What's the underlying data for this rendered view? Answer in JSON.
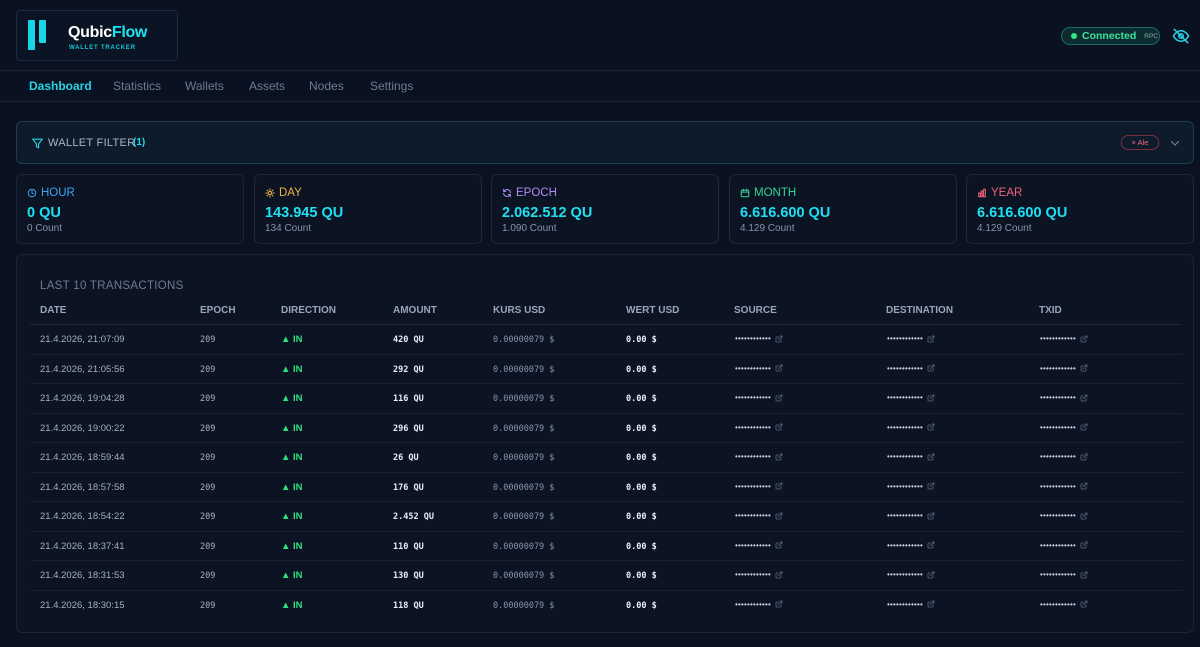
{
  "brand": {
    "name_white": "Qubic",
    "name_cyan": "Flow",
    "subtitle": "WALLET TRACKER"
  },
  "status": {
    "connected_label": "Connected",
    "rpc_label": "RPC"
  },
  "nav": {
    "tabs": [
      {
        "label": "Dashboard"
      },
      {
        "label": "Statistics"
      },
      {
        "label": "Wallets"
      },
      {
        "label": "Assets"
      },
      {
        "label": "Nodes"
      },
      {
        "label": "Settings"
      }
    ],
    "active": "Dashboard"
  },
  "filter": {
    "label": "WALLET FILTER",
    "count": "(1)",
    "tag": "× Ale"
  },
  "stats": [
    {
      "label": "HOUR",
      "value": "0 QU",
      "count": "0 Count",
      "color": "#3aa6f0",
      "icon": "clock-icon"
    },
    {
      "label": "DAY",
      "value": "143.945 QU",
      "count": "134 Count",
      "color": "#f2b33d",
      "icon": "sun-icon"
    },
    {
      "label": "EPOCH",
      "value": "2.062.512 QU",
      "count": "1.090 Count",
      "color": "#b18cf2",
      "icon": "refresh-icon"
    },
    {
      "label": "MONTH",
      "value": "6.616.600 QU",
      "count": "4.129 Count",
      "color": "#34d399",
      "icon": "calendar-icon"
    },
    {
      "label": "YEAR",
      "value": "6.616.600 QU",
      "count": "4.129 Count",
      "color": "#f2617a",
      "icon": "bar-chart-icon"
    }
  ],
  "transactions": {
    "title": "LAST 10 TRANSACTIONS",
    "columns": [
      "DATE",
      "EPOCH",
      "DIRECTION",
      "AMOUNT",
      "KURS USD",
      "WERT USD",
      "SOURCE",
      "DESTINATION",
      "TXID"
    ],
    "masked": "••••••••••••",
    "rows": [
      {
        "date": "21.4.2026, 21:07:09",
        "epoch": "209",
        "direction": "▲ IN",
        "amount": "420 QU",
        "kurs": "0.00000079 $",
        "wert": "0.00 $"
      },
      {
        "date": "21.4.2026, 21:05:56",
        "epoch": "209",
        "direction": "▲ IN",
        "amount": "292 QU",
        "kurs": "0.00000079 $",
        "wert": "0.00 $"
      },
      {
        "date": "21.4.2026, 19:04:28",
        "epoch": "209",
        "direction": "▲ IN",
        "amount": "116 QU",
        "kurs": "0.00000079 $",
        "wert": "0.00 $"
      },
      {
        "date": "21.4.2026, 19:00:22",
        "epoch": "209",
        "direction": "▲ IN",
        "amount": "296 QU",
        "kurs": "0.00000079 $",
        "wert": "0.00 $"
      },
      {
        "date": "21.4.2026, 18:59:44",
        "epoch": "209",
        "direction": "▲ IN",
        "amount": "26 QU",
        "kurs": "0.00000079 $",
        "wert": "0.00 $"
      },
      {
        "date": "21.4.2026, 18:57:58",
        "epoch": "209",
        "direction": "▲ IN",
        "amount": "176 QU",
        "kurs": "0.00000079 $",
        "wert": "0.00 $"
      },
      {
        "date": "21.4.2026, 18:54:22",
        "epoch": "209",
        "direction": "▲ IN",
        "amount": "2.452 QU",
        "kurs": "0.00000079 $",
        "wert": "0.00 $"
      },
      {
        "date": "21.4.2026, 18:37:41",
        "epoch": "209",
        "direction": "▲ IN",
        "amount": "110 QU",
        "kurs": "0.00000079 $",
        "wert": "0.00 $"
      },
      {
        "date": "21.4.2026, 18:31:53",
        "epoch": "209",
        "direction": "▲ IN",
        "amount": "130 QU",
        "kurs": "0.00000079 $",
        "wert": "0.00 $"
      },
      {
        "date": "21.4.2026, 18:30:15",
        "epoch": "209",
        "direction": "▲ IN",
        "amount": "118 QU",
        "kurs": "0.00000079 $",
        "wert": "0.00 $"
      }
    ]
  }
}
